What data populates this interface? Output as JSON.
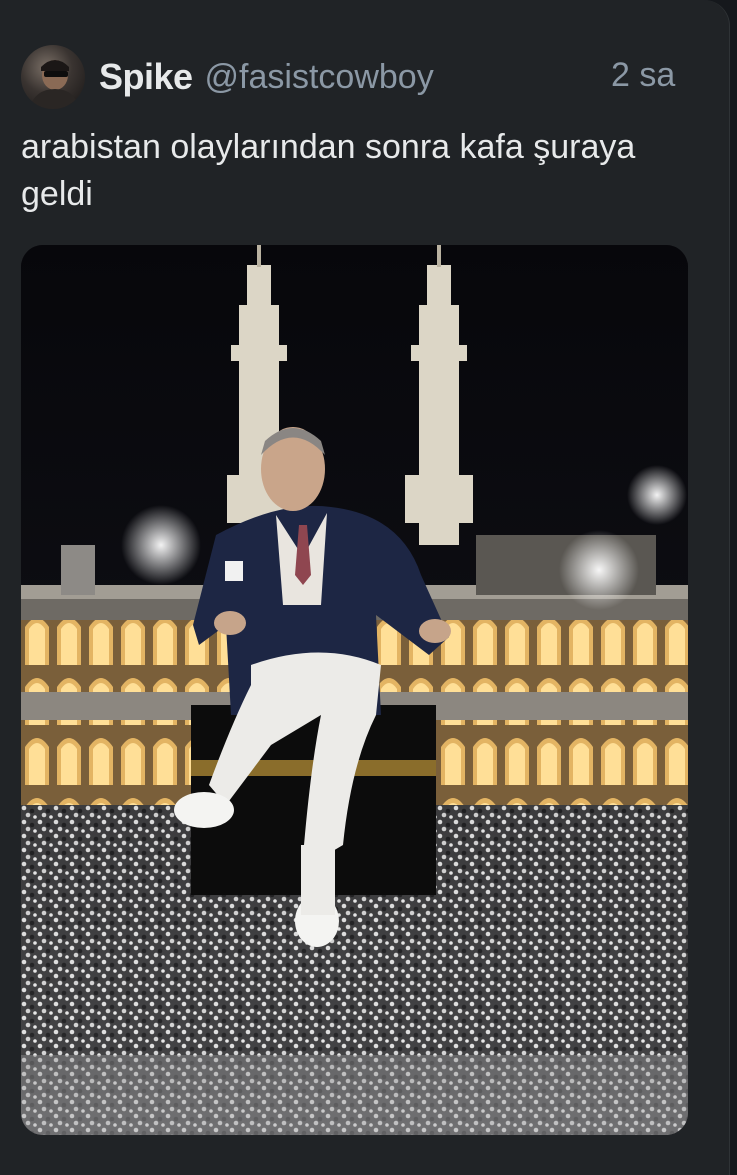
{
  "tweet": {
    "display_name": "Spike",
    "handle": "@fasistcowboy",
    "timestamp": "2 sa",
    "text": "arabistan olaylarından sonra kafa şuraya geldi",
    "avatar_icon": "user-avatar",
    "media_icon": "photo-image"
  },
  "colors": {
    "background": "#15181c",
    "card": "#202326",
    "primary_text": "#e7e9ea",
    "secondary_text": "#8b98a5"
  }
}
